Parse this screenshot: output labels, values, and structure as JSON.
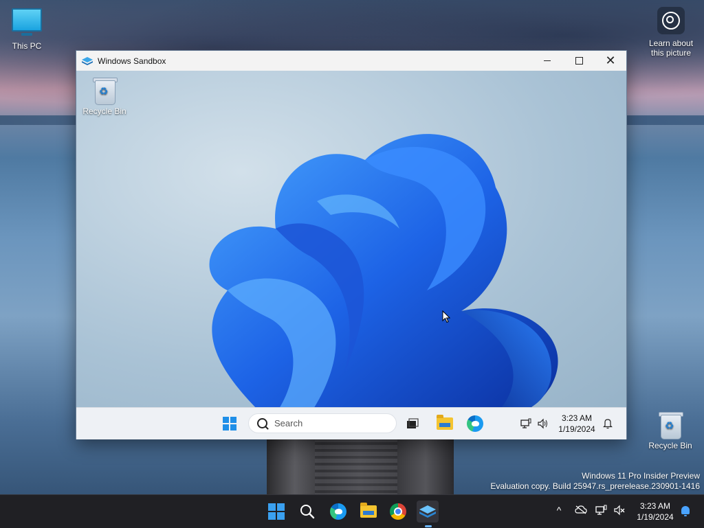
{
  "desktop": {
    "this_pc_label": "This PC",
    "recycle_bin_label": "Recycle Bin",
    "learn_label": "Learn about this picture",
    "watermark_line1": "Windows 11 Pro Insider Preview",
    "watermark_line2": "Evaluation copy. Build 25947.rs_prerelease.230901-1416"
  },
  "window": {
    "title": "Windows Sandbox",
    "minimize_icon": "minimize-icon",
    "maximize_icon": "maximize-icon",
    "close_icon": "close-icon"
  },
  "sandbox": {
    "recycle_bin_label": "Recycle Bin",
    "wallpaper": "Windows 11 bloom",
    "taskbar": {
      "search_placeholder": "Search",
      "apps": [
        "start-icon",
        "task-view-icon",
        "file-explorer-icon",
        "edge-icon"
      ],
      "tray": [
        "network-icon",
        "volume-icon"
      ],
      "time": "3:23 AM",
      "date": "1/19/2024"
    }
  },
  "taskbar": {
    "apps": [
      "start-icon",
      "search-icon",
      "edge-beta-icon",
      "file-explorer-icon",
      "chrome-icon",
      "windows-sandbox-icon"
    ],
    "tray_chevron": "^",
    "tray": [
      "onedrive-icon",
      "network-icon",
      "volume-muted-icon"
    ],
    "time": "3:23 AM",
    "date": "1/19/2024"
  },
  "colors": {
    "accent": "#3aa0f0",
    "taskbar_bg": "#202024",
    "bloom_blue": "#1f5fe0"
  }
}
